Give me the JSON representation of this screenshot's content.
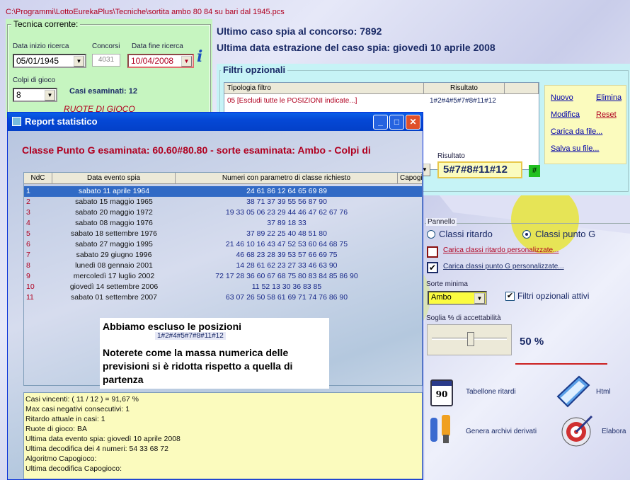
{
  "path": "C:\\Programmi\\LottoEurekaPlus\\Tecniche\\sortita ambo 80 84 su bari dal 1945.pcs",
  "tecnica": {
    "legend": "Tecnica corrente:",
    "data_inizio_label": "Data inizio ricerca",
    "data_inizio": "05/01/1945",
    "concorsi_label": "Concorsi",
    "concorsi": "4031",
    "data_fine_label": "Data fine ricerca",
    "data_fine": "10/04/2008",
    "colpi_label": "Colpi di gioco",
    "colpi": "8",
    "casi_esaminati": "Casi esaminati: 12",
    "ruote_label": "RUOTE  DI  GIOCO"
  },
  "info": {
    "ultimo_caso": "Ultimo caso spia al concorso:  7892",
    "ultima_data": "Ultima data estrazione del caso spia:  giovedì 10 aprile 2008"
  },
  "filtri": {
    "legend": "Filtri opzionali",
    "col_tipologia": "Tipologia filtro",
    "col_risultato": "Risultato",
    "row_tipologia": "05 [Escludi tutte le POSIZIONI indicate...]",
    "row_risultato": "1#2#4#5#7#8#11#12",
    "risultato_label": "Risultato",
    "risultato_value": "5#7#8#11#12",
    "hash_btn": "#"
  },
  "actions": {
    "nuovo": "Nuovo",
    "elimina": "Elimina",
    "modifica": "Modifica",
    "reset": "Reset",
    "carica": "Carica da file...",
    "salva": "Salva su file..."
  },
  "pannello": {
    "legend": "Pannello",
    "classi_ritardo": "Classi ritardo",
    "classi_punto_g": "Classi punto G",
    "carica_ritardo": "Carica classi ritardo personalizzate...",
    "carica_punto_g": "Carica classi punto G personalizzate...",
    "sorte_label": "Sorte minima",
    "sorte_value": "Ambo",
    "filtri_attivi": "Filtri opzionali attivi",
    "soglia_label": "Soglia % di accettabilità",
    "soglia_value": "50 %",
    "soglia_level": 0.5
  },
  "tools": {
    "tabellone": "Tabellone ritardi",
    "calendar_num": "90",
    "html": "Html",
    "genera": "Genera archivi derivati",
    "elabora": "Elabora"
  },
  "report": {
    "title": "Report statistico",
    "heading": "Classe Punto G esaminata: 60.60#80.80 - sorte esaminata: Ambo - Colpi di",
    "col_ndc": "NdC",
    "col_data": "Data evento spia",
    "col_numeri": "Numeri con parametro di classe richiesto",
    "col_capogioco": "Capogi",
    "rows": [
      {
        "n": "1",
        "data": "sabato 11 aprile 1964",
        "numeri": "24 61 86 12 64 65 69 89"
      },
      {
        "n": "2",
        "data": "sabato 15 maggio 1965",
        "numeri": "38 71 37 39 55 56 87 90"
      },
      {
        "n": "3",
        "data": "sabato 20 maggio 1972",
        "numeri": "19 33 05 06 23 29 44 46 47 62 67 76"
      },
      {
        "n": "4",
        "data": "sabato 08 maggio 1976",
        "numeri": "37 89 18 33"
      },
      {
        "n": "5",
        "data": "sabato 18 settembre 1976",
        "numeri": "37 89 22 25 40 48 51 80"
      },
      {
        "n": "6",
        "data": "sabato 27 maggio 1995",
        "numeri": "21 46 10 16 43 47 52 53 60 64 68 75"
      },
      {
        "n": "7",
        "data": "sabato 29 giugno 1996",
        "numeri": "46 68 23 28 39 53 57 66 69 75"
      },
      {
        "n": "8",
        "data": "lunedì 08 gennaio 2001",
        "numeri": "14 28 61 62 23 27 33 46 63 90"
      },
      {
        "n": "9",
        "data": "mercoledì 17 luglio 2002",
        "numeri": "72 17 28 36 60 67 68 75 80 83 84 85 86 90"
      },
      {
        "n": "10",
        "data": "giovedì 14 settembre 2006",
        "numeri": "11 52 13 30 36 83 85"
      },
      {
        "n": "11",
        "data": "sabato 01 settembre 2007",
        "numeri": "63 07 26 50 58 61 69 71 74 76 86 90"
      }
    ],
    "note_title": "Abbiamo escluso le posizioni",
    "note_code": "1#2#4#5#7#8#11#12",
    "note_body": "Noterete come la massa numerica delle previsioni si è ridotta rispetto a quella di partenza",
    "summary": [
      "Casi vincenti: ( 11 / 12 ) = 91,67 %",
      "Max casi negativi consecutivi: 1",
      "Ritardo attuale in casi: 1",
      "Ruote di gioco: BA",
      "Ultima data evento spia: giovedì 10 aprile 2008",
      "Ultima decodifica dei 4 numeri: 54 33 68 72",
      "Algoritmo Capogioco:",
      "Ultima decodifica Capogioco:"
    ]
  }
}
